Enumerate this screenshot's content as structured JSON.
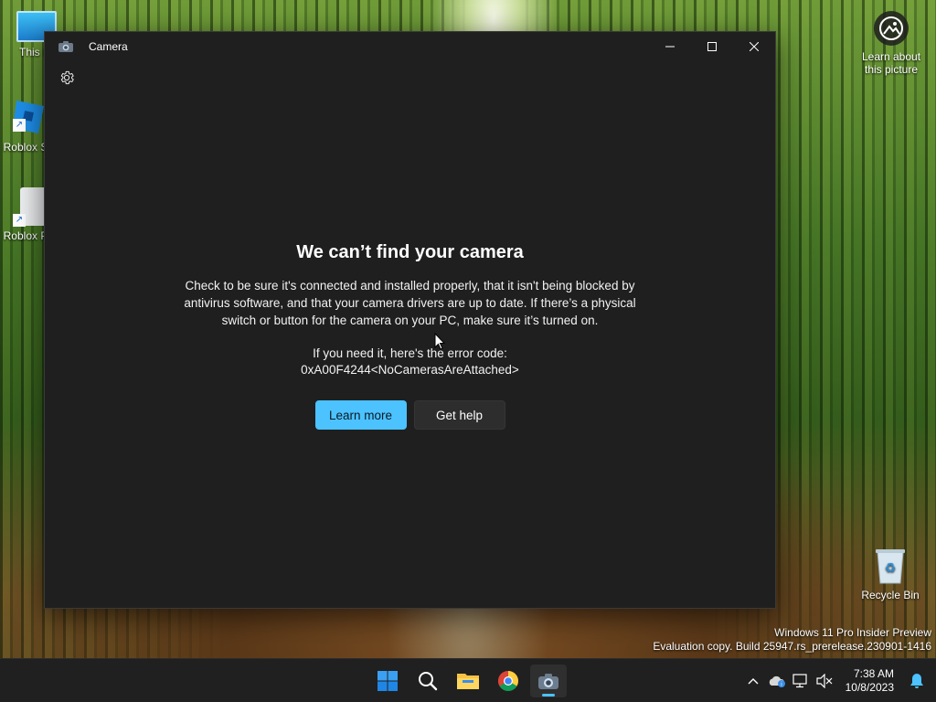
{
  "desktop": {
    "icons": [
      {
        "label": "This P"
      },
      {
        "label": "Roblox S"
      },
      {
        "label": "Roblox P"
      },
      {
        "label": "Recycle Bin"
      }
    ],
    "learn_about_picture": "Learn about this picture",
    "watermark_line1": "Windows 11 Pro Insider Preview",
    "watermark_line2": "Evaluation copy. Build 25947.rs_prerelease.230901-1416"
  },
  "window": {
    "title": "Camera",
    "controls": {
      "minimize": "minimize-icon",
      "maximize": "maximize-icon",
      "close": "close-icon"
    }
  },
  "error": {
    "heading": "We can’t find your camera",
    "body": "Check to be sure it's connected and installed properly, that it isn't being blocked by antivirus software, and that your camera drivers are up to date. If there’s a physical switch or button for the camera on your PC, make sure it’s turned on.",
    "code_intro": "If you need it, here's the error code:",
    "code": "0xA00F4244<NoCamerasAreAttached>",
    "learn_more_label": "Learn more",
    "get_help_label": "Get help"
  },
  "taskbar": {
    "apps": [
      "start-icon",
      "search-icon",
      "file-explorer-icon",
      "chrome-icon",
      "camera-icon"
    ],
    "time": "7:38 AM",
    "date": "10/8/2023"
  },
  "colors": {
    "accent": "#4cc2ff",
    "window_bg": "#1f1f1f",
    "taskbar_bg": "#202020"
  }
}
